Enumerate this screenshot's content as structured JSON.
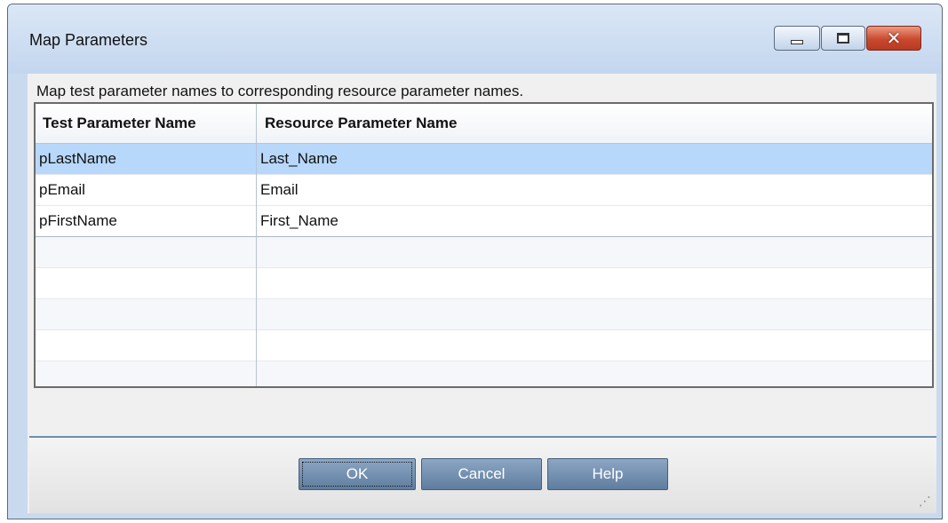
{
  "window": {
    "title": "Map Parameters"
  },
  "instructions": "Map test parameter names to corresponding resource parameter names.",
  "grid": {
    "columns": [
      "Test Parameter Name",
      "Resource Parameter Name"
    ],
    "rows": [
      {
        "test": "pLastName",
        "resource": "Last_Name",
        "selected": true
      },
      {
        "test": "pEmail",
        "resource": "Email",
        "selected": false
      },
      {
        "test": "pFirstName",
        "resource": "First_Name",
        "selected": false
      }
    ]
  },
  "buttons": {
    "ok": "OK",
    "cancel": "Cancel",
    "help": "Help"
  },
  "icons": {
    "minimize": "minimize-icon",
    "maximize": "maximize-icon",
    "close": "close-icon"
  },
  "colors": {
    "selected_row": "#b8d8fb",
    "button": "#6f8bab",
    "close_button": "#c9492d"
  }
}
